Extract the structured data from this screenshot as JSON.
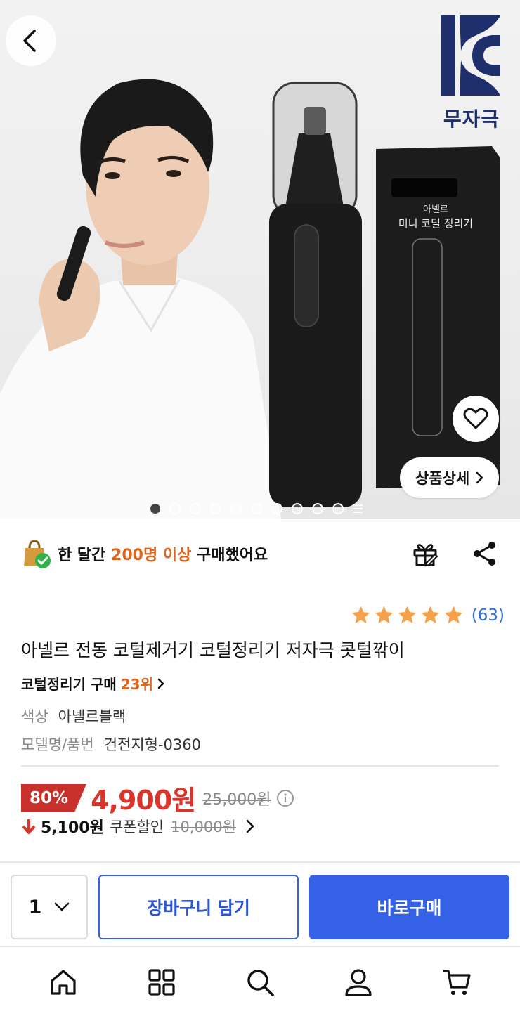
{
  "hero": {
    "kc_mark": "KC",
    "kc_label": "무자극",
    "box_brand": "아넬르",
    "box_product": "미니 코털 정리기",
    "detail_button": "상품상세",
    "image_count": 10,
    "active_image": 1
  },
  "social_proof": {
    "prefix": "한 달간 ",
    "highlight": "200명 이상",
    "suffix": " 구매했어요"
  },
  "rating": {
    "stars": 5,
    "count": "(63)"
  },
  "product": {
    "title": "아넬르 전동 코털제거기 코털정리기 저자극 콧털깎이",
    "rank_prefix": "코털정리기 구매",
    "rank_value": "23위",
    "options": [
      {
        "label": "색상",
        "value": "아넬르블랙"
      },
      {
        "label": "모델명/품번",
        "value": "건전지형-0360"
      }
    ]
  },
  "price": {
    "discount": "80%",
    "sale": "4,900원",
    "original": "25,000원"
  },
  "coupon": {
    "price": "5,100원",
    "label": "쿠폰할인",
    "original": "10,000원"
  },
  "actions": {
    "quantity": "1",
    "cart": "장바구니 담기",
    "buy": "바로구매"
  },
  "colors": {
    "accent_blue": "#3461e6",
    "price_red": "#d8352c",
    "highlight_orange": "#e0641a",
    "star": "#f5a04a"
  },
  "tabs": [
    "home-icon",
    "category-icon",
    "search-icon",
    "user-icon",
    "cart-icon"
  ]
}
